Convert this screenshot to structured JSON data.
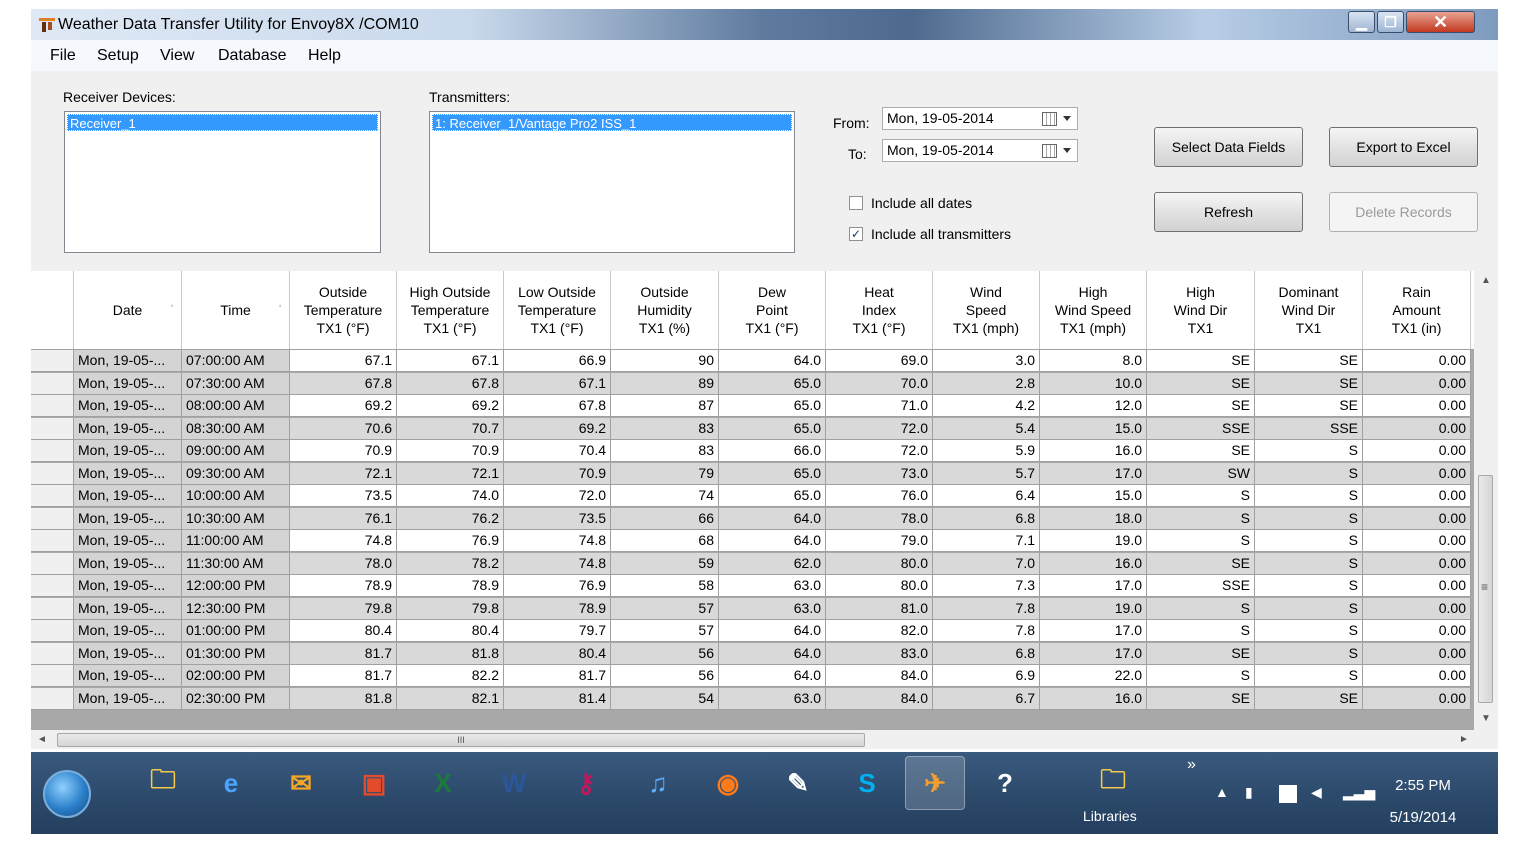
{
  "window": {
    "title": "Weather Data Transfer Utility for Envoy8X /COM10",
    "min": "▁",
    "max": "❐",
    "close": "✕"
  },
  "menu": [
    "File",
    "Setup",
    "View",
    "Database",
    "Help"
  ],
  "receivers": {
    "label": "Receiver Devices:",
    "items": [
      "Receiver_1"
    ]
  },
  "transmitters": {
    "label": "Transmitters:",
    "items": [
      "1: Receiver_1/Vantage Pro2 ISS_1"
    ]
  },
  "dates": {
    "from_label": "From:",
    "from_value": "Mon, 19-05-2014",
    "to_label": "To:",
    "to_value": "Mon, 19-05-2014"
  },
  "options": {
    "all_dates": "Include all dates",
    "all_dates_checked": false,
    "all_tx": "Include all transmitters",
    "all_tx_checked": true
  },
  "buttons": {
    "select_fields": "Select Data Fields",
    "export": "Export to Excel",
    "refresh": "Refresh",
    "delete": "Delete Records"
  },
  "table": {
    "headers": [
      [
        "Date"
      ],
      [
        "Time"
      ],
      [
        "Outside",
        "Temperature",
        "TX1 (°F)"
      ],
      [
        "High Outside",
        "Temperature",
        "TX1 (°F)"
      ],
      [
        "Low Outside",
        "Temperature",
        "TX1 (°F)"
      ],
      [
        "Outside",
        "Humidity",
        "TX1 (%)"
      ],
      [
        "Dew",
        "Point",
        "TX1 (°F)"
      ],
      [
        "Heat",
        "Index",
        "TX1 (°F)"
      ],
      [
        "Wind",
        "Speed",
        "TX1 (mph)"
      ],
      [
        "High",
        "Wind Speed",
        "TX1 (mph)"
      ],
      [
        "High",
        "Wind Dir",
        "TX1"
      ],
      [
        "Dominant",
        "Wind Dir",
        "TX1"
      ],
      [
        "Rain",
        "Amount",
        "TX1 (in)"
      ]
    ],
    "rows": [
      [
        "Mon, 19-05-...",
        "07:00:00 AM",
        "67.1",
        "67.1",
        "66.9",
        "90",
        "64.0",
        "69.0",
        "3.0",
        "8.0",
        "SE",
        "SE",
        "0.00"
      ],
      [
        "Mon, 19-05-...",
        "07:30:00 AM",
        "67.8",
        "67.8",
        "67.1",
        "89",
        "65.0",
        "70.0",
        "2.8",
        "10.0",
        "SE",
        "SE",
        "0.00"
      ],
      [
        "Mon, 19-05-...",
        "08:00:00 AM",
        "69.2",
        "69.2",
        "67.8",
        "87",
        "65.0",
        "71.0",
        "4.2",
        "12.0",
        "SE",
        "SE",
        "0.00"
      ],
      [
        "Mon, 19-05-...",
        "08:30:00 AM",
        "70.6",
        "70.7",
        "69.2",
        "83",
        "65.0",
        "72.0",
        "5.4",
        "15.0",
        "SSE",
        "SSE",
        "0.00"
      ],
      [
        "Mon, 19-05-...",
        "09:00:00 AM",
        "70.9",
        "70.9",
        "70.4",
        "83",
        "66.0",
        "72.0",
        "5.9",
        "16.0",
        "SE",
        "S",
        "0.00"
      ],
      [
        "Mon, 19-05-...",
        "09:30:00 AM",
        "72.1",
        "72.1",
        "70.9",
        "79",
        "65.0",
        "73.0",
        "5.7",
        "17.0",
        "SW",
        "S",
        "0.00"
      ],
      [
        "Mon, 19-05-...",
        "10:00:00 AM",
        "73.5",
        "74.0",
        "72.0",
        "74",
        "65.0",
        "76.0",
        "6.4",
        "15.0",
        "S",
        "S",
        "0.00"
      ],
      [
        "Mon, 19-05-...",
        "10:30:00 AM",
        "76.1",
        "76.2",
        "73.5",
        "66",
        "64.0",
        "78.0",
        "6.8",
        "18.0",
        "S",
        "S",
        "0.00"
      ],
      [
        "Mon, 19-05-...",
        "11:00:00 AM",
        "74.8",
        "76.9",
        "74.8",
        "68",
        "64.0",
        "79.0",
        "7.1",
        "19.0",
        "S",
        "S",
        "0.00"
      ],
      [
        "Mon, 19-05-...",
        "11:30:00 AM",
        "78.0",
        "78.2",
        "74.8",
        "59",
        "62.0",
        "80.0",
        "7.0",
        "16.0",
        "SE",
        "S",
        "0.00"
      ],
      [
        "Mon, 19-05-...",
        "12:00:00 PM",
        "78.9",
        "78.9",
        "76.9",
        "58",
        "63.0",
        "80.0",
        "7.3",
        "17.0",
        "SSE",
        "S",
        "0.00"
      ],
      [
        "Mon, 19-05-...",
        "12:30:00 PM",
        "79.8",
        "79.8",
        "78.9",
        "57",
        "63.0",
        "81.0",
        "7.8",
        "19.0",
        "S",
        "S",
        "0.00"
      ],
      [
        "Mon, 19-05-...",
        "01:00:00 PM",
        "80.4",
        "80.4",
        "79.7",
        "57",
        "64.0",
        "82.0",
        "7.8",
        "17.0",
        "S",
        "S",
        "0.00"
      ],
      [
        "Mon, 19-05-...",
        "01:30:00 PM",
        "81.7",
        "81.8",
        "80.4",
        "56",
        "64.0",
        "83.0",
        "6.8",
        "17.0",
        "SE",
        "S",
        "0.00"
      ],
      [
        "Mon, 19-05-...",
        "02:00:00 PM",
        "81.7",
        "82.2",
        "81.7",
        "56",
        "64.0",
        "84.0",
        "6.9",
        "22.0",
        "S",
        "S",
        "0.00"
      ],
      [
        "Mon, 19-05-...",
        "02:30:00 PM",
        "81.8",
        "82.1",
        "81.4",
        "54",
        "63.0",
        "84.0",
        "6.7",
        "16.0",
        "SE",
        "SE",
        "0.00"
      ]
    ]
  },
  "scroll": {
    "h_grip": "III",
    "left": "◄",
    "right": "►",
    "up": "▲",
    "down": "▼",
    "v_grip": "≡"
  },
  "taskbar": {
    "apps": [
      {
        "icon": "folder-icon",
        "glyph": "🗀",
        "color": "#f2c94c"
      },
      {
        "icon": "internet-explorer-icon",
        "glyph": "e",
        "color": "#4aa3ff"
      },
      {
        "icon": "outlook-icon",
        "glyph": "✉",
        "color": "#f5a623"
      },
      {
        "icon": "access-icon",
        "glyph": "▣",
        "color": "#e34b2a"
      },
      {
        "icon": "excel-icon",
        "glyph": "X",
        "color": "#1d7a3a"
      },
      {
        "icon": "word-icon",
        "glyph": "W",
        "color": "#2b579a"
      },
      {
        "icon": "key-icon",
        "glyph": "⚷",
        "color": "#c2185b"
      },
      {
        "icon": "itunes-icon",
        "glyph": "♫",
        "color": "#5ab0ff"
      },
      {
        "icon": "firefox-icon",
        "glyph": "◉",
        "color": "#ff7a1a"
      },
      {
        "icon": "feather-icon",
        "glyph": "✎",
        "color": "#ffffff"
      },
      {
        "icon": "skype-icon",
        "glyph": "S",
        "color": "#00aff0"
      },
      {
        "icon": "weather-app-icon",
        "glyph": "✈",
        "color": "#f0a030"
      },
      {
        "icon": "help-icon",
        "glyph": "?",
        "color": "#ffffff"
      }
    ],
    "libraries": "Libraries",
    "chevron": "»",
    "time": "2:55 PM",
    "date": "5/19/2014"
  }
}
